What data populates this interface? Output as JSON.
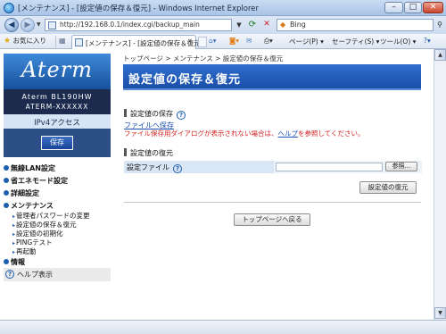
{
  "window": {
    "title": "[メンテナンス] - [設定値の保存＆復元] - Windows Internet Explorer",
    "min_symbol": "–",
    "max_symbol": "□",
    "close_symbol": "✕"
  },
  "address_bar": {
    "url": "http://192.168.0.1/index.cgi/backup_main",
    "search_text": "Bing"
  },
  "toolbar": {
    "favorites_label": "お気に入り",
    "tab_label": "[メンテナンス] - [設定値の保存＆復元]",
    "page_menu": "ページ(P)",
    "safety_menu": "セーフティ(S)",
    "tools_menu": "ツール(O)",
    "help_symbol": "?"
  },
  "sidebar": {
    "logo": "Aterm",
    "model_name": "Aterm BL190HW",
    "model_code": "ATERM-XXXXXX",
    "mode": "IPv4アクセス",
    "save_label": "保存",
    "menu": [
      {
        "label": "無線LAN設定"
      },
      {
        "label": "省エネモード設定"
      },
      {
        "label": "詳細設定"
      },
      {
        "label": "メンテナンス"
      }
    ],
    "submenu": [
      {
        "label": "管理者パスワードの変更"
      },
      {
        "label": "設定値の保存＆復元"
      },
      {
        "label": "設定値の初期化"
      },
      {
        "label": "PINGテスト"
      },
      {
        "label": "再起動"
      }
    ],
    "info_label": "情報",
    "help_label": "ヘルプ表示"
  },
  "main": {
    "breadcrumb": "トップページ > メンテナンス > 設定値の保存＆復元",
    "title": "設定値の保存＆復元",
    "save_section": {
      "heading": "設定値の保存",
      "link": "ファイルへ保存",
      "note_prefix": "ファイル保存用ダイアログが表示されない場合は、",
      "note_link": "ヘルプ",
      "note_suffix": "を参照してください。"
    },
    "restore_section": {
      "heading": "設定値の復元",
      "field_label": "設定ファイル",
      "browse_label": "参照...",
      "restore_label": "設定値の復元"
    },
    "back_to_top_label": "トップページへ戻る"
  },
  "colors": {
    "accent": "#1a4fa8",
    "warning": "#d12020",
    "link": "#1c4fb0"
  }
}
